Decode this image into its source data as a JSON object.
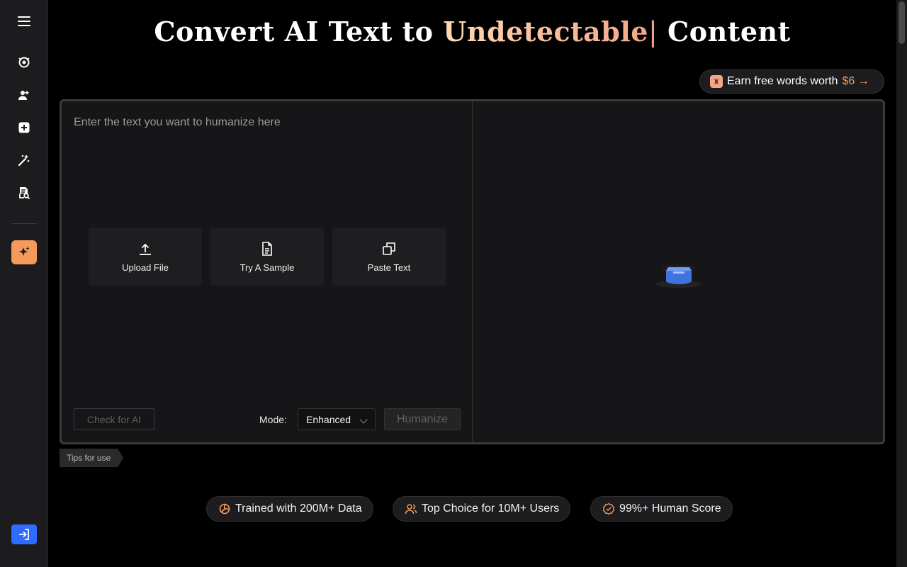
{
  "sidebar": {
    "icons": [
      "menu-icon",
      "detector-icon",
      "humanizer-icon",
      "add-icon",
      "magic-icon",
      "document-search-icon",
      "sparkle-icon",
      "login-icon"
    ]
  },
  "header": {
    "title_part1": "Convert AI Text to ",
    "title_highlight": "Undetectable",
    "title_cursor": "|",
    "title_part2": " Content"
  },
  "earn": {
    "label": "Earn free words worth",
    "amount": "$6",
    "arrow": "→"
  },
  "editor": {
    "placeholder": "Enter the text you want to humanize here",
    "actions": [
      {
        "label": "Upload File",
        "icon": "upload-icon"
      },
      {
        "label": "Try A Sample",
        "icon": "document-icon"
      },
      {
        "label": "Paste Text",
        "icon": "paste-icon"
      }
    ],
    "check_label": "Check for AI",
    "mode_label": "Mode:",
    "mode_value": "Enhanced",
    "humanize_label": "Humanize"
  },
  "tips_label": "Tips for use",
  "stats": [
    {
      "label": "Trained with 200M+ Data",
      "icon": "chart-pie-icon"
    },
    {
      "label": "Top Choice for 10M+ Users",
      "icon": "users-icon"
    },
    {
      "label": "99%+ Human Score",
      "icon": "verified-badge-icon"
    }
  ],
  "colors": {
    "accent": "#f59a5a",
    "highlight_start": "#ffd9b0",
    "highlight_end": "#f3a68a",
    "primary_blue": "#2f6bff"
  }
}
